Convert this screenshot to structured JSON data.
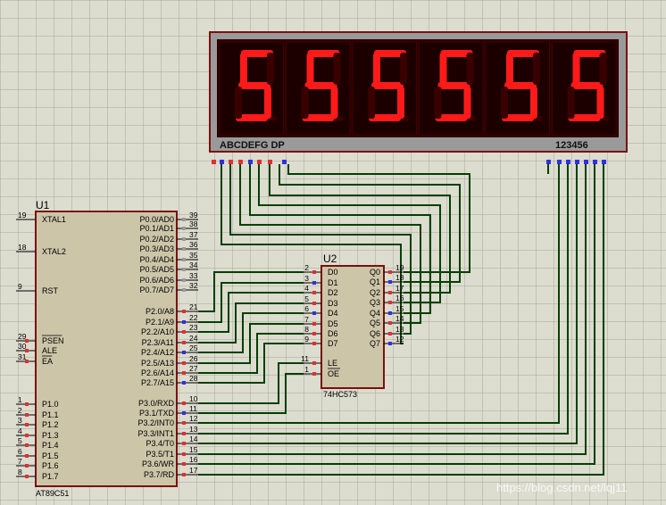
{
  "display": {
    "digits": [
      "5",
      "5",
      "5",
      "5",
      "5",
      "5"
    ],
    "segment_label": "ABCDEFG DP",
    "common_label": "123456",
    "frame_color": "#9a9a9a",
    "on_color": "#ff1a1a",
    "off_color": "#3a0000"
  },
  "u1": {
    "ref": "U1",
    "part": "AT89C51",
    "left_pins": [
      {
        "num": "19",
        "name": "XTAL1"
      },
      {
        "num": "18",
        "name": "XTAL2"
      },
      {
        "num": "9",
        "name": "RST"
      },
      {
        "num": "29",
        "name": "PSEN",
        "bar": true
      },
      {
        "num": "30",
        "name": "ALE"
      },
      {
        "num": "31",
        "name": "EA",
        "bar": true
      },
      {
        "num": "1",
        "name": "P1.0"
      },
      {
        "num": "2",
        "name": "P1.1"
      },
      {
        "num": "3",
        "name": "P1.2"
      },
      {
        "num": "4",
        "name": "P1.3"
      },
      {
        "num": "5",
        "name": "P1.4"
      },
      {
        "num": "6",
        "name": "P1.5"
      },
      {
        "num": "7",
        "name": "P1.6"
      },
      {
        "num": "8",
        "name": "P1.7"
      }
    ],
    "right_pins": [
      {
        "num": "39",
        "name": "P0.0/AD0"
      },
      {
        "num": "38",
        "name": "P0.1/AD1"
      },
      {
        "num": "37",
        "name": "P0.2/AD2"
      },
      {
        "num": "36",
        "name": "P0.3/AD3"
      },
      {
        "num": "35",
        "name": "P0.4/AD4"
      },
      {
        "num": "34",
        "name": "P0.5/AD5"
      },
      {
        "num": "33",
        "name": "P0.6/AD6"
      },
      {
        "num": "32",
        "name": "P0.7/AD7"
      },
      {
        "num": "21",
        "name": "P2.0/A8"
      },
      {
        "num": "22",
        "name": "P2.1/A9"
      },
      {
        "num": "23",
        "name": "P2.2/A10"
      },
      {
        "num": "24",
        "name": "P2.3/A11"
      },
      {
        "num": "25",
        "name": "P2.4/A12"
      },
      {
        "num": "26",
        "name": "P2.5/A13"
      },
      {
        "num": "27",
        "name": "P2.6/A14"
      },
      {
        "num": "28",
        "name": "P2.7/A15"
      },
      {
        "num": "10",
        "name": "P3.0/RXD"
      },
      {
        "num": "11",
        "name": "P3.1/TXD"
      },
      {
        "num": "12",
        "name": "P3.2/INT0"
      },
      {
        "num": "13",
        "name": "P3.3/INT1"
      },
      {
        "num": "14",
        "name": "P3.4/T0"
      },
      {
        "num": "15",
        "name": "P3.5/T1"
      },
      {
        "num": "16",
        "name": "P3.6/WR"
      },
      {
        "num": "17",
        "name": "P3.7/RD"
      }
    ]
  },
  "u2": {
    "ref": "U2",
    "part": "74HC573",
    "left_pins": [
      {
        "num": "2",
        "name": "D0"
      },
      {
        "num": "3",
        "name": "D1"
      },
      {
        "num": "4",
        "name": "D2"
      },
      {
        "num": "5",
        "name": "D3"
      },
      {
        "num": "6",
        "name": "D4"
      },
      {
        "num": "7",
        "name": "D5"
      },
      {
        "num": "8",
        "name": "D6"
      },
      {
        "num": "9",
        "name": "D7"
      },
      {
        "num": "11",
        "name": "LE"
      },
      {
        "num": "1",
        "name": "OE"
      }
    ],
    "right_pins": [
      {
        "num": "19",
        "name": "Q0"
      },
      {
        "num": "18",
        "name": "Q1"
      },
      {
        "num": "17",
        "name": "Q2"
      },
      {
        "num": "16",
        "name": "Q3"
      },
      {
        "num": "15",
        "name": "Q4"
      },
      {
        "num": "14",
        "name": "Q5"
      },
      {
        "num": "13",
        "name": "Q6"
      },
      {
        "num": "12",
        "name": "Q7"
      }
    ]
  },
  "watermark": "https://blog.csdn.net/lqj11"
}
